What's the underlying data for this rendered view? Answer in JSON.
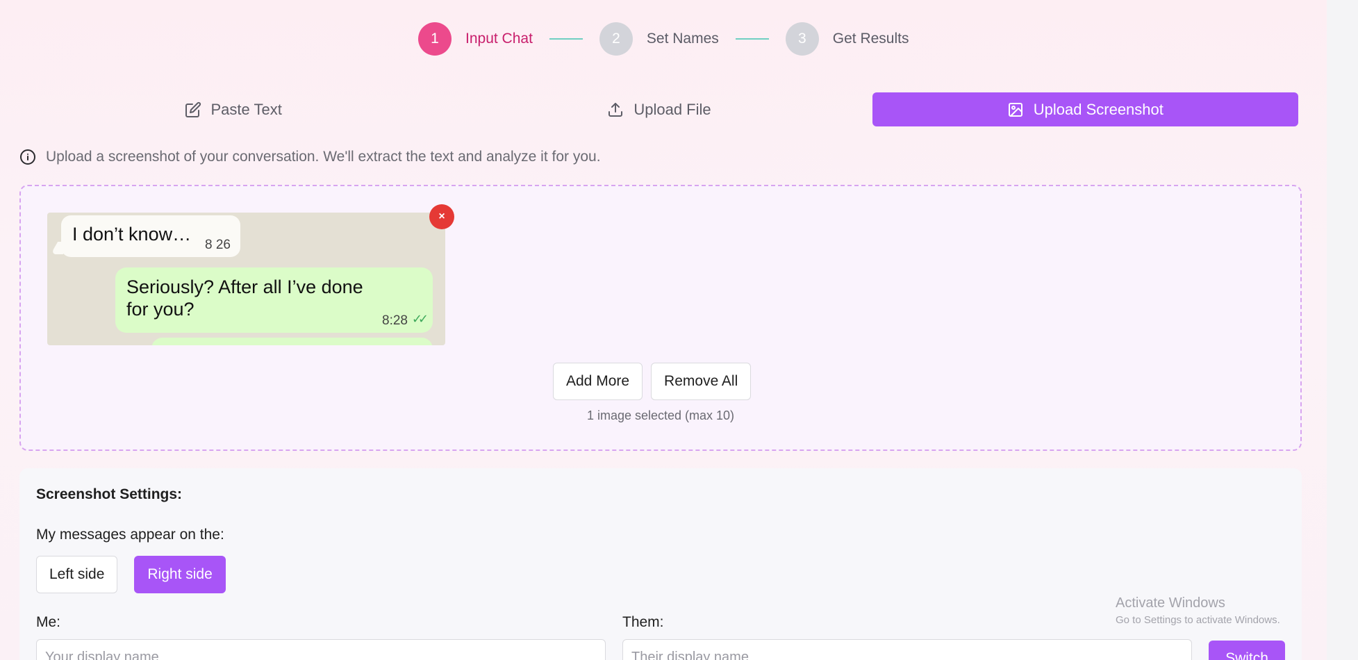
{
  "stepper": {
    "steps": [
      {
        "number": "1",
        "label": "Input Chat"
      },
      {
        "number": "2",
        "label": "Set Names"
      },
      {
        "number": "3",
        "label": "Get Results"
      }
    ]
  },
  "tabs": [
    {
      "label": "Paste Text",
      "icon": "edit-icon"
    },
    {
      "label": "Upload File",
      "icon": "upload-icon"
    },
    {
      "label": "Upload Screenshot",
      "icon": "image-icon"
    }
  ],
  "info_text": "Upload a screenshot of your conversation. We'll extract the text and analyze it for you.",
  "thumbnail": {
    "left_message": "I don’t know…",
    "left_time": "8 26",
    "right_message_line1": "Seriously? After all I’ve done",
    "right_message_line2": "for you?",
    "right_time": "8:28",
    "ticks": "✓✓",
    "remove_symbol": "×"
  },
  "dropzone": {
    "add_more": "Add More",
    "remove_all": "Remove All",
    "selected_count": "1 image selected (max 10)"
  },
  "settings": {
    "title": "Screenshot Settings:",
    "side_label": "My messages appear on the:",
    "left_side": "Left side",
    "right_side": "Right side",
    "me_label": "Me:",
    "me_placeholder": "Your display name",
    "them_label": "Them:",
    "them_placeholder": "Their display name",
    "switch": "Switch"
  },
  "watermark": {
    "line1": "Activate Windows",
    "line2": "Go to Settings to activate Windows."
  },
  "colors": {
    "accent": "#a855f7",
    "step_active": "#ec4a8c",
    "remove": "#e53935"
  }
}
